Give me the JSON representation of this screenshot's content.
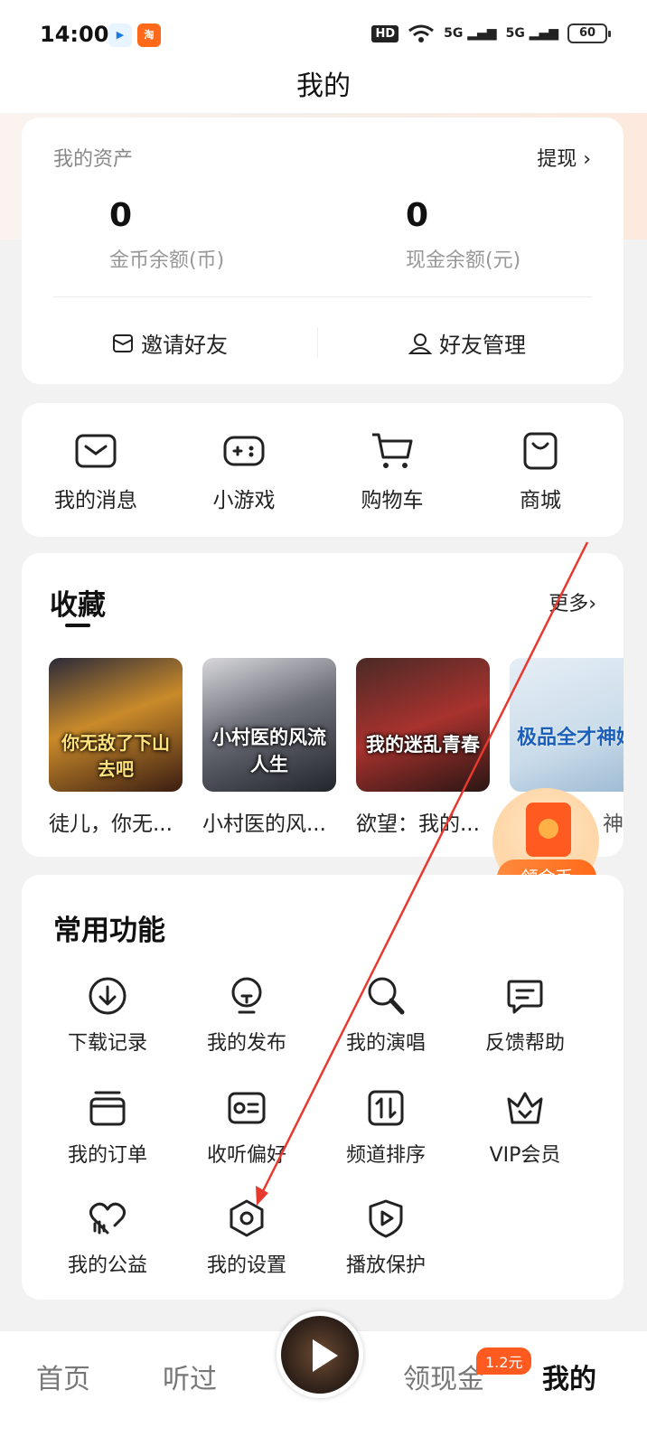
{
  "status_bar": {
    "time": "14:00",
    "battery": "60",
    "app1": "▶",
    "app2": "淘",
    "hd": "HD",
    "signal1": "5G",
    "signal2": "5G"
  },
  "header": {
    "title": "我的"
  },
  "assets": {
    "label": "我的资产",
    "withdraw": "提现 ›",
    "coin_value": "0",
    "coin_label": "金币余额(币)",
    "cash_value": "0",
    "cash_label": "现金余额(元)",
    "invite_label": "邀请好友",
    "manage_label": "好友管理"
  },
  "quick": [
    {
      "label": "我的消息",
      "icon": "message-icon"
    },
    {
      "label": "小游戏",
      "icon": "gamepad-icon"
    },
    {
      "label": "购物车",
      "icon": "cart-icon"
    },
    {
      "label": "商城",
      "icon": "shopping-bag-icon"
    }
  ],
  "favorites": {
    "title": "收藏",
    "more": "更多›",
    "books": [
      {
        "title": "徒儿，你无...",
        "cover_text": "你无敌了下山去吧"
      },
      {
        "title": "小村医的风...",
        "cover_text": "小村医的风流人生"
      },
      {
        "title": "欲望：我的...",
        "cover_text": "我的迷乱青春"
      },
      {
        "title": "神",
        "cover_text": "极品全才神婿"
      }
    ]
  },
  "coin_float": {
    "label": "领金币"
  },
  "common": {
    "title": "常用功能",
    "items": [
      {
        "label": "下载记录",
        "icon": "download-icon"
      },
      {
        "label": "我的发布",
        "icon": "publish-icon"
      },
      {
        "label": "我的演唱",
        "icon": "sing-icon"
      },
      {
        "label": "反馈帮助",
        "icon": "feedback-icon"
      },
      {
        "label": "我的订单",
        "icon": "order-icon"
      },
      {
        "label": "收听偏好",
        "icon": "preference-icon"
      },
      {
        "label": "频道排序",
        "icon": "sort-icon"
      },
      {
        "label": "VIP会员",
        "icon": "crown-icon"
      },
      {
        "label": "我的公益",
        "icon": "charity-icon"
      },
      {
        "label": "我的设置",
        "icon": "settings-icon"
      },
      {
        "label": "播放保护",
        "icon": "shield-play-icon"
      }
    ]
  },
  "nav": {
    "home": "首页",
    "history": "听过",
    "cash": "领现金",
    "mine": "我的",
    "badge": "1.2元"
  },
  "colors": {
    "accent": "#ff5a1f",
    "annotation_arrow": "#e8392e"
  }
}
